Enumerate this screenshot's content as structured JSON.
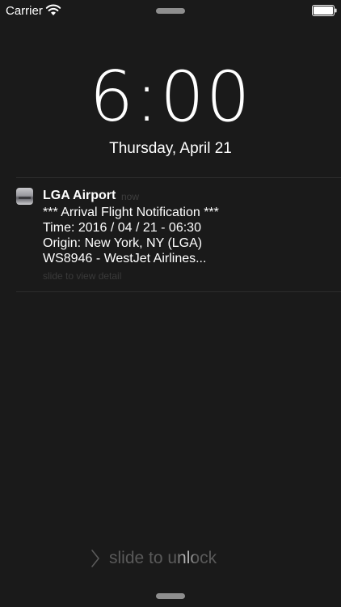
{
  "status_bar": {
    "carrier": "Carrier",
    "wifi_icon": "wifi-icon",
    "battery_icon": "battery-icon"
  },
  "lock_screen": {
    "time": "6:00",
    "date": "Thursday, April 21"
  },
  "notification": {
    "app_name": "LGA Airport",
    "time": "now",
    "app_icon": "airport-app-icon",
    "lines": [
      "*** Arrival Flight Notification ***",
      "Time: 2016 / 04 / 21 - 06:30",
      "Origin: New York, NY (LGA)",
      "WS8946 - WestJet Airlines..."
    ],
    "hint": "slide to view detail"
  },
  "unlock": {
    "label": "slide to unlock",
    "icon": "chevron-right-icon"
  },
  "colors": {
    "background": "#1a1a1a",
    "text": "#ffffff",
    "muted_text": "#3e3e3e",
    "grabber": "#8e8e8e"
  }
}
